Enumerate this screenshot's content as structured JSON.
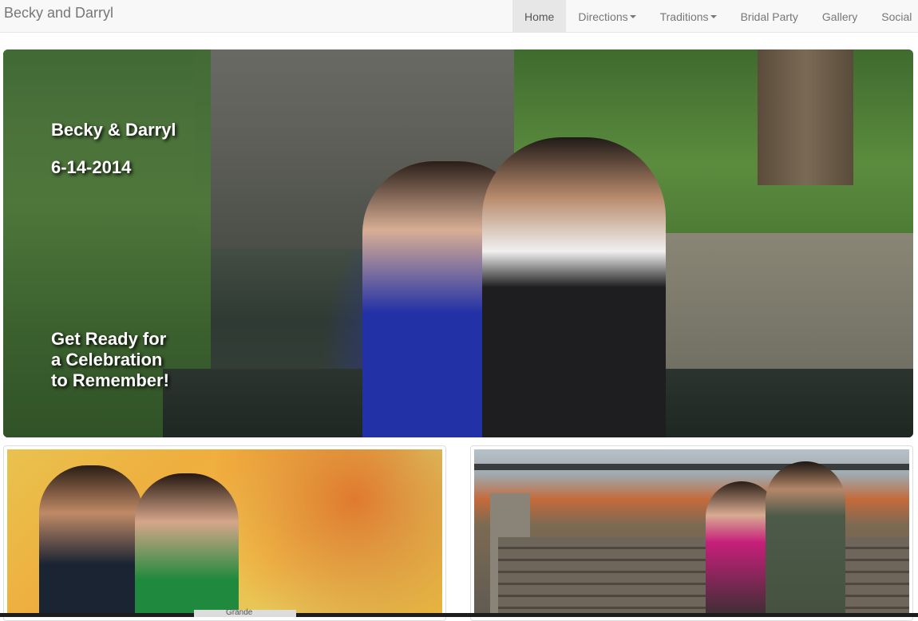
{
  "navbar": {
    "brand": "Becky and Darryl",
    "items": [
      {
        "label": "Home",
        "active": true,
        "dropdown": false
      },
      {
        "label": "Directions",
        "active": false,
        "dropdown": true
      },
      {
        "label": "Traditions",
        "active": false,
        "dropdown": true
      },
      {
        "label": "Bridal Party",
        "active": false,
        "dropdown": false
      },
      {
        "label": "Gallery",
        "active": false,
        "dropdown": false
      },
      {
        "label": "Social",
        "active": false,
        "dropdown": false
      }
    ]
  },
  "hero": {
    "names": "Becky & Darryl",
    "date": "6-14-2014",
    "tagline": "Get Ready for\na Celebration\nto Remember!"
  },
  "footer_strip": {
    "chip_text": "Grande"
  },
  "colors": {
    "navbar_bg": "#f8f8f8",
    "active_tab_bg": "#e7e7e7",
    "nav_text": "#777777",
    "hero_text": "#ffffff"
  }
}
